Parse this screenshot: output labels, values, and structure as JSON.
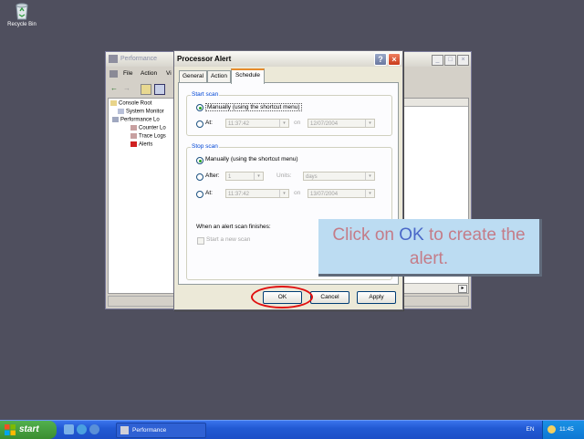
{
  "desktop": {
    "recycle_bin_label": "Recycle Bin"
  },
  "perf_window": {
    "title": "Performance",
    "menu": [
      "File",
      "Action",
      "Vi"
    ],
    "tree": [
      "Console Root",
      "System Monitor",
      "Performance Lo",
      "Counter Lo",
      "Trace Logs",
      "Alerts"
    ],
    "controls": {
      "minimize": "_",
      "maximize": "□",
      "close": "×"
    }
  },
  "dialog": {
    "title": "Processor Alert",
    "help": "?",
    "close": "×",
    "tabs": [
      "General",
      "Action",
      "Schedule"
    ],
    "active_tab": "Schedule",
    "start_scan": {
      "legend": "Start scan",
      "option_manual": "Manually (using the shortcut menu)",
      "option_at": "At:",
      "time": "11:37:42",
      "on_label": "on",
      "date": "12/07/2004"
    },
    "stop_scan": {
      "legend": "Stop scan",
      "option_manual": "Manually (using the shortcut menu)",
      "option_after": "After:",
      "after_value": "1",
      "units_label": "Units:",
      "units_value": "days",
      "option_at": "At:",
      "time": "11:37:42",
      "on_label": "on",
      "date": "13/07/2004"
    },
    "finish_label": "When an alert scan finishes:",
    "new_scan_label": "Start a new scan",
    "buttons": {
      "ok": "OK",
      "cancel": "Cancel",
      "apply": "Apply"
    }
  },
  "callout": {
    "before": "Click on ",
    "highlight": "OK",
    "after": " to create the alert."
  },
  "taskbar": {
    "start_label": "start",
    "task_label": "Performance",
    "language": "EN",
    "clock": "11:45"
  }
}
